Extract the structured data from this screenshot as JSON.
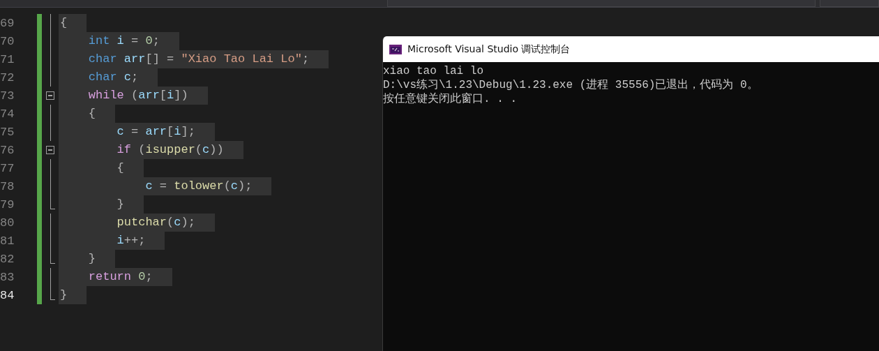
{
  "editor": {
    "lines": [
      {
        "number": "69",
        "kind": "line",
        "selected": true,
        "tokens": [
          {
            "kind": "punct",
            "t": "{"
          }
        ]
      },
      {
        "number": "70",
        "kind": "line",
        "selected": true,
        "tokens": [
          {
            "kind": "keyword",
            "t": "    int"
          },
          {
            "kind": "var",
            "t": " i"
          },
          {
            "kind": "punct",
            "t": " = "
          },
          {
            "kind": "number",
            "t": "0"
          },
          {
            "kind": "punct",
            "t": ";"
          }
        ]
      },
      {
        "number": "71",
        "kind": "line",
        "selected": true,
        "tokens": [
          {
            "kind": "keyword",
            "t": "    char"
          },
          {
            "kind": "var",
            "t": " arr"
          },
          {
            "kind": "punct",
            "t": "[] = "
          },
          {
            "kind": "string",
            "t": "\"Xiao Tao Lai Lo\""
          },
          {
            "kind": "punct",
            "t": ";"
          }
        ]
      },
      {
        "number": "72",
        "kind": "line",
        "selected": true,
        "tokens": [
          {
            "kind": "keyword",
            "t": "    char"
          },
          {
            "kind": "var",
            "t": " c"
          },
          {
            "kind": "punct",
            "t": ";"
          }
        ]
      },
      {
        "number": "73",
        "kind": "open",
        "selected": true,
        "tokens": [
          {
            "kind": "control",
            "t": "    while"
          },
          {
            "kind": "punct",
            "t": " ("
          },
          {
            "kind": "var",
            "t": "arr"
          },
          {
            "kind": "punct",
            "t": "["
          },
          {
            "kind": "var",
            "t": "i"
          },
          {
            "kind": "punct",
            "t": "])"
          }
        ]
      },
      {
        "number": "74",
        "kind": "line",
        "selected": true,
        "tokens": [
          {
            "kind": "punct",
            "t": "    {"
          }
        ]
      },
      {
        "number": "75",
        "kind": "line",
        "selected": true,
        "tokens": [
          {
            "kind": "var",
            "t": "        c"
          },
          {
            "kind": "punct",
            "t": " = "
          },
          {
            "kind": "var",
            "t": "arr"
          },
          {
            "kind": "punct",
            "t": "["
          },
          {
            "kind": "var",
            "t": "i"
          },
          {
            "kind": "punct",
            "t": "];"
          }
        ]
      },
      {
        "number": "76",
        "kind": "open",
        "selected": true,
        "tokens": [
          {
            "kind": "control",
            "t": "        if"
          },
          {
            "kind": "punct",
            "t": " ("
          },
          {
            "kind": "func",
            "t": "isupper"
          },
          {
            "kind": "punct",
            "t": "("
          },
          {
            "kind": "var",
            "t": "c"
          },
          {
            "kind": "punct",
            "t": "))"
          }
        ]
      },
      {
        "number": "77",
        "kind": "line",
        "selected": true,
        "tokens": [
          {
            "kind": "punct",
            "t": "        {"
          }
        ]
      },
      {
        "number": "78",
        "kind": "line",
        "selected": true,
        "tokens": [
          {
            "kind": "var",
            "t": "            c"
          },
          {
            "kind": "punct",
            "t": " = "
          },
          {
            "kind": "func",
            "t": "tolower"
          },
          {
            "kind": "punct",
            "t": "("
          },
          {
            "kind": "var",
            "t": "c"
          },
          {
            "kind": "punct",
            "t": ");"
          }
        ]
      },
      {
        "number": "79",
        "kind": "end",
        "selected": true,
        "tokens": [
          {
            "kind": "punct",
            "t": "        }"
          }
        ]
      },
      {
        "number": "80",
        "kind": "line",
        "selected": true,
        "tokens": [
          {
            "kind": "func",
            "t": "        putchar"
          },
          {
            "kind": "punct",
            "t": "("
          },
          {
            "kind": "var",
            "t": "c"
          },
          {
            "kind": "punct",
            "t": ");"
          }
        ]
      },
      {
        "number": "81",
        "kind": "line",
        "selected": true,
        "tokens": [
          {
            "kind": "var",
            "t": "        i"
          },
          {
            "kind": "punct",
            "t": "++;"
          }
        ]
      },
      {
        "number": "82",
        "kind": "end",
        "selected": true,
        "tokens": [
          {
            "kind": "punct",
            "t": "    }"
          }
        ]
      },
      {
        "number": "83",
        "kind": "line",
        "selected": true,
        "tokens": [
          {
            "kind": "control",
            "t": "    return"
          },
          {
            "kind": "number",
            "t": " 0"
          },
          {
            "kind": "punct",
            "t": ";"
          }
        ]
      },
      {
        "number": "84",
        "kind": "end",
        "selected": true,
        "current": true,
        "tokens": [
          {
            "kind": "punct",
            "t": "}"
          }
        ]
      }
    ]
  },
  "console": {
    "title": "Microsoft Visual Studio 调试控制台",
    "output": [
      "xiao tao lai lo",
      "D:\\vs练习\\1.23\\Debug\\1.23.exe (进程 35556)已退出，代码为 0。",
      "按任意键关闭此窗口. . ."
    ]
  }
}
